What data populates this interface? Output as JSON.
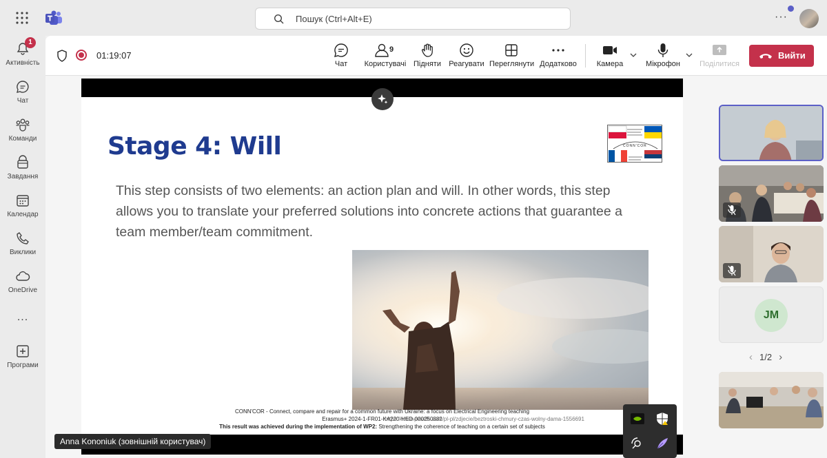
{
  "titlebar": {
    "search_placeholder": "Пошук (Ctrl+Alt+E)"
  },
  "rail": [
    {
      "label": "Активність",
      "icon": "bell-icon",
      "badge": "1"
    },
    {
      "label": "Чат",
      "icon": "chat-icon"
    },
    {
      "label": "Команди",
      "icon": "teams-icon"
    },
    {
      "label": "Завдання",
      "icon": "tasks-icon"
    },
    {
      "label": "Календар",
      "icon": "calendar-icon"
    },
    {
      "label": "Виклики",
      "icon": "phone-icon"
    },
    {
      "label": "OneDrive",
      "icon": "cloud-icon"
    },
    {
      "label": "...",
      "icon": "more-icon"
    },
    {
      "label": "Програми",
      "icon": "apps-icon"
    }
  ],
  "meeting": {
    "timer": "01:19:07",
    "tools": {
      "chat": "Чат",
      "people": "Користувачі",
      "people_count": "9",
      "raise": "Підняти",
      "react": "Реагувати",
      "view": "Переглянути",
      "more": "Додатково",
      "camera": "Камера",
      "mic": "Мікрофон",
      "share": "Поділитися"
    },
    "leave": "Вийти",
    "presenter_name": "Anna Kononiuk (зовнішній користувач)",
    "pager": "1/2"
  },
  "slide": {
    "title": "Stage 4: Will",
    "body": "This step consists of two elements: an action plan and will. In other words, this step allows you to translate your preferred solutions into concrete actions that guarantee a team member/team commitment.",
    "footer_line1": "CONN'COR - Connect, compare and repair for a common future with Ukraine: a focus on Electrical Engineering teaching",
    "footer_line2": "Erasmus+ 2024-1-FR01-KA220-HED-000250882",
    "footer_line3_bold": "This result was achieved during the implementation of WP2:",
    "footer_line3_rest": " Strengthening the coherence of teaching on a certain set of subjects",
    "footer_url": "https://www.pexels.com/pl-pl/zdjecie/beztroski-chmury-czas-wolny-dama-1556691",
    "logo_text": "CONN'COR"
  },
  "participants": [
    {
      "initials": "JM"
    }
  ],
  "colors": {
    "accent": "#5b5fc7",
    "leave": "#c4314b",
    "title_blue": "#1f3b8f"
  }
}
